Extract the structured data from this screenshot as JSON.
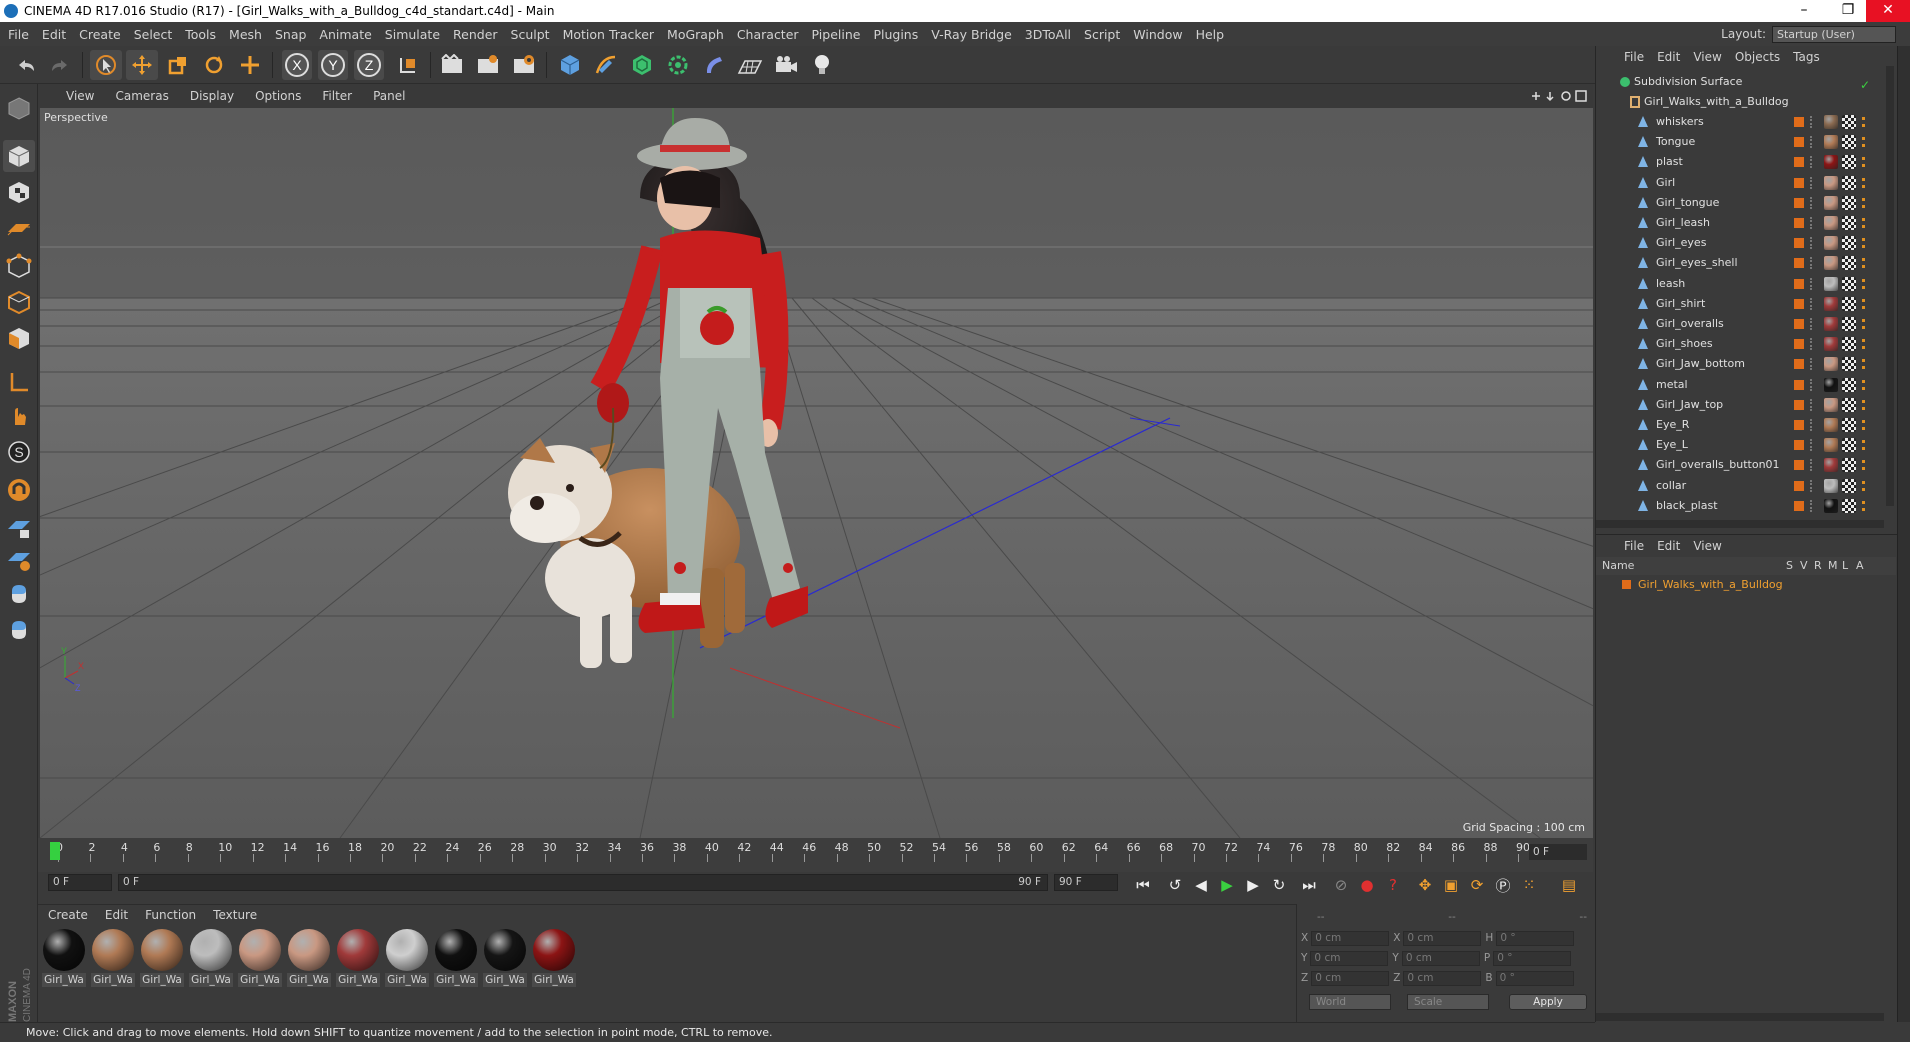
{
  "window": {
    "title": "CINEMA 4D R17.016 Studio (R17) - [Girl_Walks_with_a_Bulldog_c4d_standart.c4d] - Main",
    "min": "–",
    "restore": "❐",
    "close": "✕"
  },
  "menubar": [
    "File",
    "Edit",
    "Create",
    "Select",
    "Tools",
    "Mesh",
    "Snap",
    "Animate",
    "Simulate",
    "Render",
    "Sculpt",
    "Motion Tracker",
    "MoGraph",
    "Character",
    "Pipeline",
    "Plugins",
    "V-Ray Bridge",
    "3DToAll",
    "Script",
    "Window",
    "Help"
  ],
  "layout": {
    "label": "Layout:",
    "value": "Startup (User)"
  },
  "toolbar": {
    "axis_x": "X",
    "axis_y": "Y",
    "axis_z": "Z"
  },
  "viewport": {
    "menu": [
      "View",
      "Cameras",
      "Display",
      "Options",
      "Filter",
      "Panel"
    ],
    "label": "Perspective",
    "grid_spacing": "Grid Spacing : 100 cm",
    "axis_y": "Y",
    "axis_z": "Z",
    "axis_x": "X"
  },
  "timeline": {
    "ticks": [
      "0",
      "2",
      "4",
      "6",
      "8",
      "10",
      "12",
      "14",
      "16",
      "18",
      "20",
      "22",
      "24",
      "26",
      "28",
      "30",
      "32",
      "34",
      "36",
      "38",
      "40",
      "42",
      "44",
      "46",
      "48",
      "50",
      "52",
      "54",
      "56",
      "58",
      "60",
      "62",
      "64",
      "66",
      "68",
      "70",
      "72",
      "74",
      "76",
      "78",
      "80",
      "82",
      "84",
      "86",
      "88",
      "90"
    ],
    "current_frame": "0 F"
  },
  "playback": {
    "start": "0 F",
    "range_start": "0 F",
    "range_end": "90 F",
    "end": "90 F"
  },
  "materials": {
    "menu": [
      "Create",
      "Edit",
      "Function",
      "Texture"
    ],
    "items": [
      {
        "label": "Girl_Wa",
        "color": "#111111"
      },
      {
        "label": "Girl_Wa",
        "color": "#b07a55"
      },
      {
        "label": "Girl_Wa",
        "color": "#b07a55"
      },
      {
        "label": "Girl_Wa",
        "color": "#bdbdbd"
      },
      {
        "label": "Girl_Wa",
        "color": "#c99882"
      },
      {
        "label": "Girl_Wa",
        "color": "#c99882"
      },
      {
        "label": "Girl_Wa",
        "color": "#a03a3a"
      },
      {
        "label": "Girl_Wa",
        "color": "#cfcfcf"
      },
      {
        "label": "Girl_Wa",
        "color": "#101010"
      },
      {
        "label": "Girl_Wa",
        "color": "#151515"
      },
      {
        "label": "Girl_Wa",
        "color": "#8c1414"
      }
    ]
  },
  "coords": {
    "header": [
      "--",
      "--",
      "--"
    ],
    "rows": [
      {
        "a": "X",
        "av": "0 cm",
        "b": "X",
        "bv": "0 cm",
        "c": "H",
        "cv": "0 °"
      },
      {
        "a": "Y",
        "av": "0 cm",
        "b": "Y",
        "bv": "0 cm",
        "c": "P",
        "cv": "0 °"
      },
      {
        "a": "Z",
        "av": "0 cm",
        "b": "Z",
        "bv": "0 cm",
        "c": "B",
        "cv": "0 °"
      }
    ],
    "world": "World",
    "scale": "Scale",
    "apply": "Apply"
  },
  "status": "Move: Click and drag to move elements. Hold down SHIFT to quantize movement / add to the selection in point mode, CTRL to remove.",
  "objects": {
    "menu": [
      "File",
      "Edit",
      "View",
      "Objects",
      "Tags"
    ],
    "root": "Subdivision Surface",
    "group": "Girl_Walks_with_a_Bulldog",
    "items": [
      {
        "name": "whiskers",
        "tag": "#8a6a50"
      },
      {
        "name": "Tongue",
        "tag": "#b07a55"
      },
      {
        "name": "plast",
        "tag": "#8c1414"
      },
      {
        "name": "Girl",
        "tag": "#c99882"
      },
      {
        "name": "Girl_tongue",
        "tag": "#c99882"
      },
      {
        "name": "Girl_leash",
        "tag": "#c99882"
      },
      {
        "name": "Girl_eyes",
        "tag": "#c99882"
      },
      {
        "name": "Girl_eyes_shell",
        "tag": "#c99882"
      },
      {
        "name": "leash",
        "tag": "#bdbdbd"
      },
      {
        "name": "Girl_shirt",
        "tag": "#a03a3a"
      },
      {
        "name": "Girl_overalls",
        "tag": "#a03a3a"
      },
      {
        "name": "Girl_shoes",
        "tag": "#a03a3a"
      },
      {
        "name": "Girl_Jaw_bottom",
        "tag": "#c99882"
      },
      {
        "name": "metal",
        "tag": "#111111"
      },
      {
        "name": "Girl_Jaw_top",
        "tag": "#c99882"
      },
      {
        "name": "Eye_R",
        "tag": "#b07a55"
      },
      {
        "name": "Eye_L",
        "tag": "#b07a55"
      },
      {
        "name": "Girl_overalls_button01",
        "tag": "#a03a3a"
      },
      {
        "name": "collar",
        "tag": "#bdbdbd"
      },
      {
        "name": "black_plast",
        "tag": "#111111"
      }
    ]
  },
  "layers": {
    "menu": [
      "File",
      "Edit",
      "View"
    ],
    "head_name": "Name",
    "head_cols": [
      "S",
      "V",
      "R",
      "M",
      "L",
      "A"
    ],
    "row": "Girl_Walks_with_a_Bulldog"
  },
  "colors": {
    "accent": "#e06c1a",
    "selection": "#f0a030",
    "panel": "#3a3a3a"
  }
}
